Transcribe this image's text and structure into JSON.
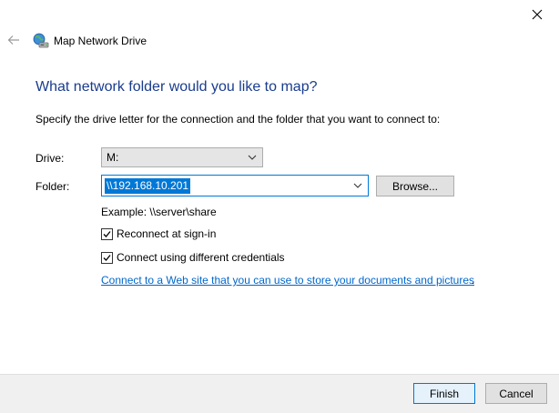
{
  "window": {
    "title": "Map Network Drive",
    "close_icon": "close-icon",
    "back_icon": "back-arrow-icon",
    "app_icon": "network-drive-icon"
  },
  "main": {
    "heading": "What network folder would you like to map?",
    "instruction": "Specify the drive letter for the connection and the folder that you want to connect to:",
    "drive_label": "Drive:",
    "drive_value": "M:",
    "folder_label": "Folder:",
    "folder_value": "\\\\192.168.10.201",
    "browse_label": "Browse...",
    "example": "Example: \\\\server\\share",
    "reconnect_label": "Reconnect at sign-in",
    "reconnect_checked": true,
    "credentials_label": "Connect using different credentials",
    "credentials_checked": true,
    "web_link": "Connect to a Web site that you can use to store your documents and pictures",
    "web_link_suffix": "."
  },
  "footer": {
    "finish_label": "Finish",
    "cancel_label": "Cancel"
  },
  "colors": {
    "heading": "#1a3c8e",
    "accent": "#0078d7",
    "link": "#0066cc",
    "footer_bg": "#f0f0f0"
  }
}
